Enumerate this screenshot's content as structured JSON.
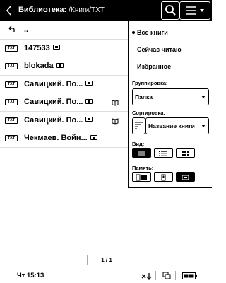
{
  "header": {
    "title": "Библиотека:",
    "path": "/Книги/TXT"
  },
  "list": {
    "up_label": "..",
    "items": [
      {
        "type": "TXT",
        "name": "147533"
      },
      {
        "type": "TXT",
        "name": "blokada"
      },
      {
        "type": "TXT",
        "name": "Савицкий. По..."
      },
      {
        "type": "TXT",
        "name": "Савицкий. По..."
      },
      {
        "type": "TXT",
        "name": "Савицкий. По..."
      },
      {
        "type": "TXT",
        "name": "Чекмаев. Войн..."
      }
    ]
  },
  "panel": {
    "filters": [
      "Все книги",
      "Сейчас читаю",
      "Избранное"
    ],
    "group_label": "Группировка:",
    "group_value": "Папка",
    "sort_label": "Сортировка:",
    "sort_value": "Название книги",
    "view_label": "Вид:",
    "memory_label": "Память:"
  },
  "pager": {
    "page": "1 / 1"
  },
  "status": {
    "time": "Чт 15:13"
  }
}
